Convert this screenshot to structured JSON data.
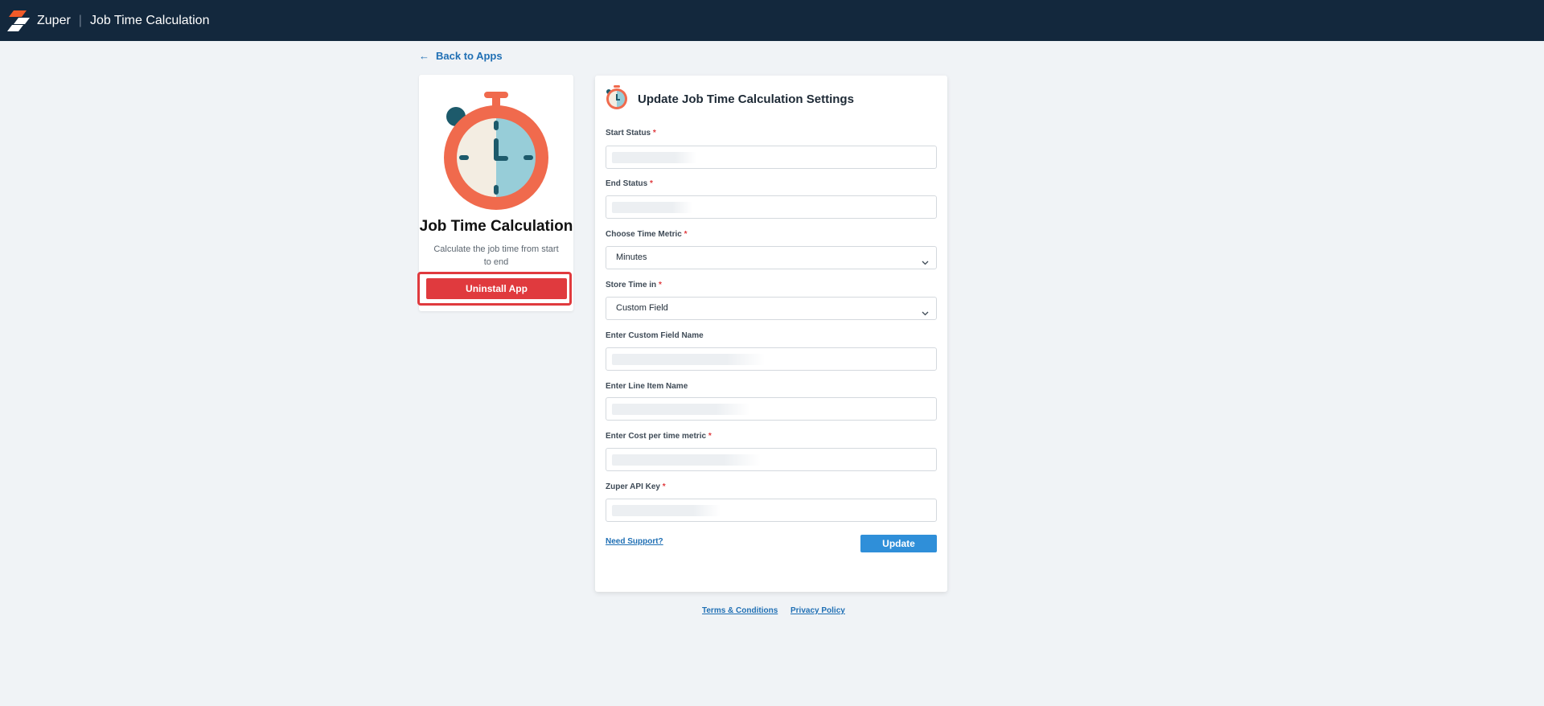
{
  "header": {
    "brand": "Zuper",
    "separator": "|",
    "app_title": "Job Time Calculation"
  },
  "back_link": "Back to Apps",
  "app_card": {
    "name": "Job Time Calculation",
    "description": "Calculate the job time from start to end",
    "uninstall_label": "Uninstall App"
  },
  "settings": {
    "title": "Update Job Time Calculation Settings",
    "fields": [
      {
        "label": "Start Status",
        "required": "*",
        "value": ""
      },
      {
        "label": "End Status",
        "required": "*",
        "value": ""
      },
      {
        "label": "Choose Time Metric",
        "required": "*",
        "value": "Minutes"
      },
      {
        "label": "Store Time in",
        "required": "*",
        "value": "Custom Field"
      },
      {
        "label": "Enter Custom Field Name",
        "required": "",
        "value": ""
      },
      {
        "label": "Enter Line Item Name",
        "required": "",
        "value": ""
      },
      {
        "label": "Enter Cost per time metric",
        "required": "*",
        "value": ""
      },
      {
        "label": "Zuper API Key",
        "required": "*",
        "value": ""
      }
    ],
    "support_label": "Need Support?",
    "update_label": "Update"
  },
  "footer": {
    "terms": "Terms & Conditions",
    "privacy": "Privacy Policy"
  },
  "colors": {
    "topbar": "#13283d",
    "accent_blue": "#2f8fd9",
    "danger_red": "#e03a3e",
    "background": "#f0f3f6"
  },
  "icons": [
    "zuper-logo-icon",
    "back-arrow-icon",
    "stopwatch-icon",
    "chevron-down-icon"
  ]
}
